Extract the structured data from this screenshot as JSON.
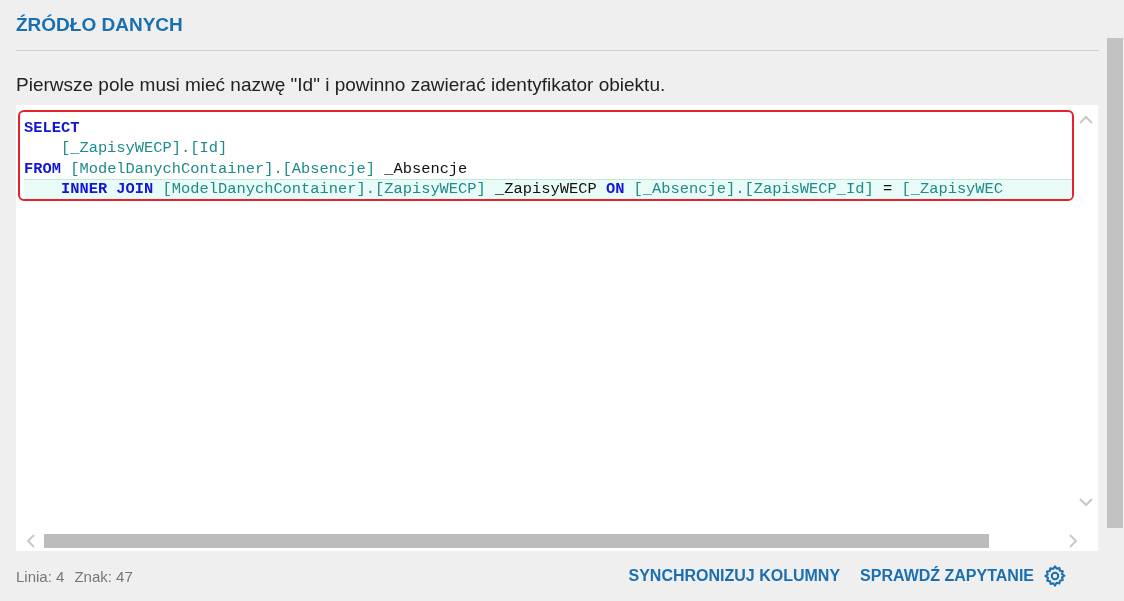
{
  "section_title": "ŹRÓDŁO DANYCH",
  "description": "Pierwsze pole musi mieć nazwę \"Id\" i powinno zawierać identyfikator obiektu.",
  "editor": {
    "lines": [
      {
        "current": false,
        "tokens": [
          {
            "kind": "keyword",
            "text": "SELECT"
          }
        ]
      },
      {
        "current": false,
        "tokens": [
          {
            "kind": "ident",
            "text": "    [_ZapisyWECP].[Id]"
          }
        ]
      },
      {
        "current": false,
        "tokens": [
          {
            "kind": "keyword",
            "text": "FROM"
          },
          {
            "kind": "ident",
            "text": " [ModelDanychContainer].[Absencje]"
          },
          {
            "kind": "plain",
            "text": " _Absencje"
          }
        ]
      },
      {
        "current": true,
        "tokens": [
          {
            "kind": "keyword",
            "text": "    INNER JOIN"
          },
          {
            "kind": "ident",
            "text": " [ModelDanychContainer].[ZapisyWECP]"
          },
          {
            "kind": "plain",
            "text": " _ZapisyWECP "
          },
          {
            "kind": "keyword",
            "text": "ON"
          },
          {
            "kind": "ident",
            "text": " [_Absencje].[ZapisWECP_Id]"
          },
          {
            "kind": "plain",
            "text": " = "
          },
          {
            "kind": "ident",
            "text": "[_ZapisyWEC"
          }
        ]
      }
    ]
  },
  "status": {
    "line": "Linia: 4",
    "char": "Znak: 47"
  },
  "actions": [
    "SYNCHRONIZUJ KOLUMNY",
    "SPRAWDŹ ZAPYTANIE"
  ]
}
